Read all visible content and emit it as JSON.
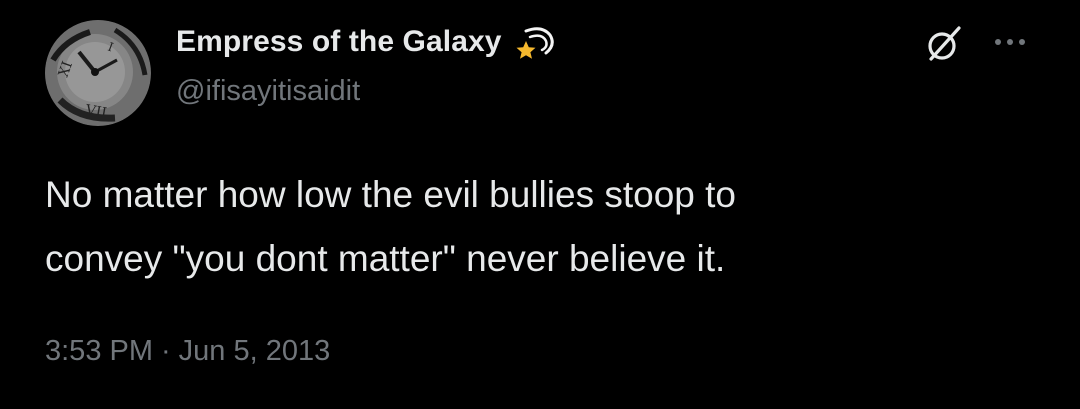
{
  "tweet": {
    "display_name": "Empress of the Galaxy",
    "name_emoji": "shooting-star-icon",
    "handle": "@ifisayitisaidit",
    "text": "No matter how low the evil bullies stoop to\nconvey \"you dont matter\" never believe it.",
    "time": "3:53 PM",
    "separator": "·",
    "date": "Jun 5, 2013"
  },
  "icons": {
    "grok": "grok-icon",
    "more": "more-options-icon"
  },
  "colors": {
    "background": "#000000",
    "primary_text": "#e7e9ea",
    "secondary_text": "#71767b",
    "star": "#f5b82e"
  }
}
